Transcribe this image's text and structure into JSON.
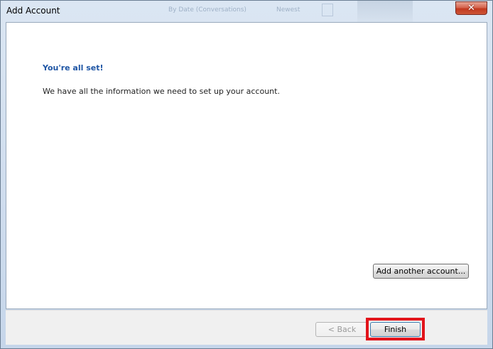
{
  "window": {
    "title": "Add Account",
    "close_label": "✕",
    "background_ghost": {
      "arrange": "By Date (Conversations)",
      "sort": "Newest"
    }
  },
  "content": {
    "heading": "You're all set!",
    "message": "We have all the information we need to set up your account.",
    "add_another_label": "Add another account..."
  },
  "footer": {
    "back_label": "< Back",
    "finish_label": "Finish"
  },
  "colors": {
    "heading": "#1f56a5",
    "highlight": "#e2141b",
    "close_button": "#c2391f"
  }
}
